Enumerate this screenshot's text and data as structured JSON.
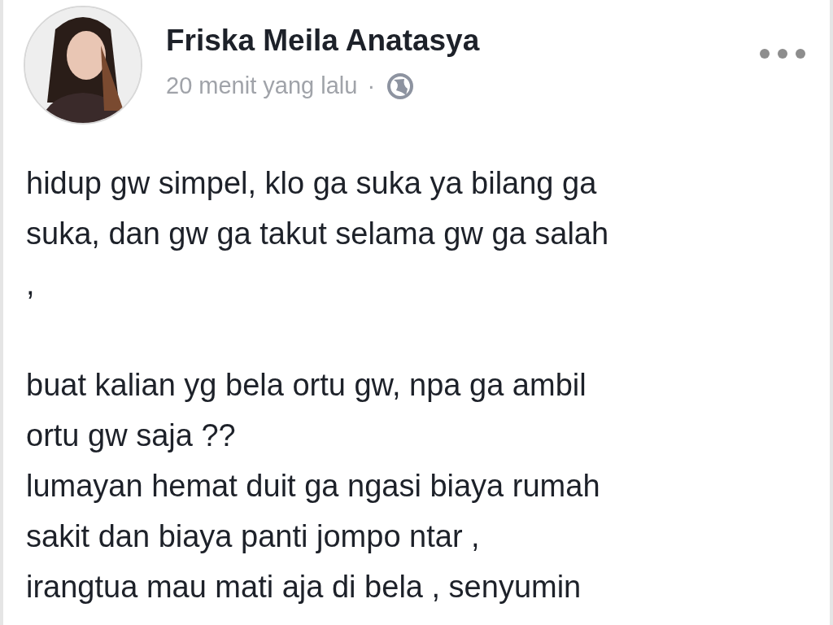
{
  "post": {
    "author": "Friska Meila Anatasya",
    "time": "20 menit yang lalu",
    "separator": "·",
    "paragraphs": [
      [
        "hidup gw simpel, klo ga suka ya bilang ga",
        "suka, dan gw ga takut selama gw ga salah",
        ","
      ],
      [
        "buat kalian yg bela ortu gw, npa ga ambil",
        "ortu gw saja ??",
        "lumayan hemat duit ga ngasi biaya rumah",
        "sakit dan biaya panti jompo ntar ,",
        "irangtua mau mati aja di bela , senyumin"
      ]
    ]
  }
}
